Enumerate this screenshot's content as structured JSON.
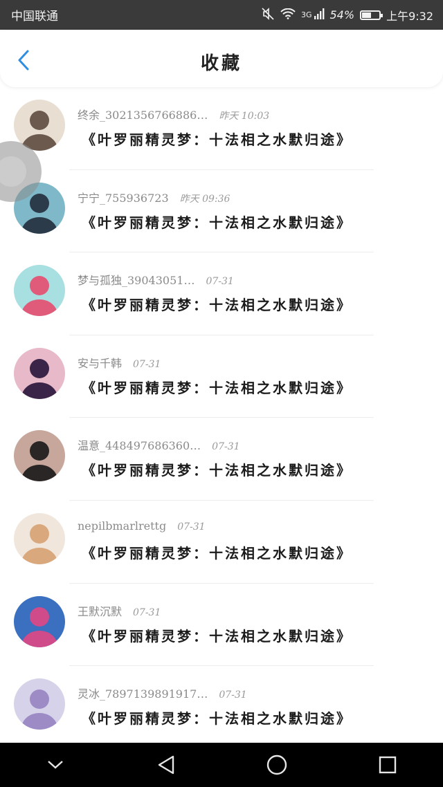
{
  "status_bar": {
    "carrier": "中国联通",
    "network": "3G",
    "battery_percent": "54%",
    "battery_level": 0.54,
    "time": "上午9:32"
  },
  "header": {
    "title": "收藏"
  },
  "items": [
    {
      "user": "终余_3021356766886…",
      "time": "昨天 10:03",
      "content": "《叶罗丽精灵梦：十法相之水默归途》",
      "avatar_colors": [
        "#e8ded2",
        "#6b5a4d"
      ]
    },
    {
      "user": "宁宁_755936723",
      "time": "昨天 09:36",
      "content": "《叶罗丽精灵梦：十法相之水默归途》",
      "avatar_colors": [
        "#7fb8c8",
        "#2b3b4a"
      ]
    },
    {
      "user": "梦与孤独_39043051…",
      "time": "07-31",
      "content": "《叶罗丽精灵梦：十法相之水默归途》",
      "avatar_colors": [
        "#a8dfe0",
        "#e05a7a"
      ]
    },
    {
      "user": "安与千韩",
      "time": "07-31",
      "content": "《叶罗丽精灵梦：十法相之水默归途》",
      "avatar_colors": [
        "#e8b9c9",
        "#3a2448"
      ]
    },
    {
      "user": "温意_448497686360…",
      "time": "07-31",
      "content": "《叶罗丽精灵梦：十法相之水默归途》",
      "avatar_colors": [
        "#c7a79b",
        "#2a2626"
      ]
    },
    {
      "user": "nepilbmarlrettg",
      "time": "07-31",
      "content": "《叶罗丽精灵梦：十法相之水默归途》",
      "avatar_colors": [
        "#f1e6dc",
        "#d9a87d"
      ]
    },
    {
      "user": "王默沉默",
      "time": "07-31",
      "content": "《叶罗丽精灵梦：十法相之水默归途》",
      "avatar_colors": [
        "#3b6fc0",
        "#d04b8a"
      ]
    },
    {
      "user": "灵冰_7897139891917…",
      "time": "07-31",
      "content": "《叶罗丽精灵梦：十法相之水默归途》",
      "avatar_colors": [
        "#d6d2ea",
        "#9d8bc6"
      ]
    }
  ],
  "colors": {
    "accent": "#2f8ee0",
    "status_bar_bg": "#3a3a3a",
    "nav_bar_bg": "#000000"
  },
  "nav": {
    "icons": [
      "chevron-down-icon",
      "back-triangle-icon",
      "home-circle-icon",
      "recent-square-icon"
    ]
  }
}
